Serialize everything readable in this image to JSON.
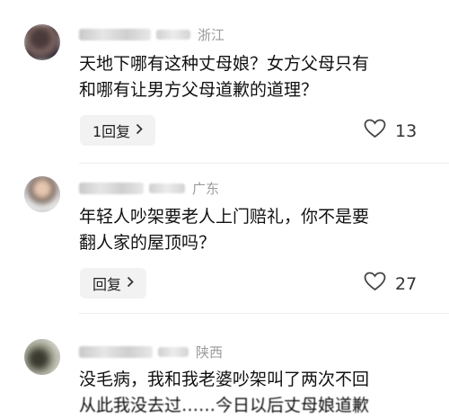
{
  "comments": [
    {
      "location": "浙江",
      "lines": [
        "天地下哪有这种丈母娘？女方父母只有",
        "和哪有让男方父母道歉的道理？"
      ],
      "reply_label": "1回复",
      "likes": "13"
    },
    {
      "location": "广东",
      "lines": [
        "年轻人吵架要老人上门赔礼，你不是要",
        "翻人家的屋顶吗？"
      ],
      "reply_label": "回复",
      "likes": "27"
    },
    {
      "location": "陕西",
      "lines": [
        "没毛病，我和我老婆吵架叫了两次不回",
        "从此我没去过……今日以后丈母娘道歉"
      ],
      "reply_label": "",
      "likes": ""
    }
  ],
  "icons": {
    "like": "heart-outline-icon",
    "reply_chevron": "chevron-right-icon"
  },
  "colors": {
    "meta_text": "#9a9a9a",
    "reply_bg": "#f2f2f2"
  }
}
